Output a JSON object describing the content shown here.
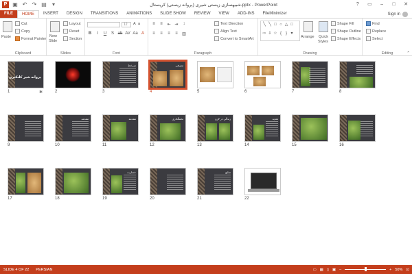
{
  "titlebar": {
    "app_icon": "P",
    "title": "شبیهسازی زیستی شیری (پروانه زیستی) کریستال.pptx - PowerPoint",
    "controls": [
      "?",
      "▭",
      "–",
      "□",
      "✕"
    ]
  },
  "tabs": [
    "FILE",
    "HOME",
    "INSERT",
    "DESIGN",
    "TRANSITIONS",
    "ANIMATIONS",
    "SLIDE SHOW",
    "REVIEW",
    "VIEW",
    "ADD-INS",
    "FileMinimizer"
  ],
  "active_tab": "HOME",
  "signin": "Sign in",
  "ribbon": {
    "clipboard": {
      "label": "Clipboard",
      "paste": "Paste",
      "cut": "Cut",
      "copy": "Copy",
      "format_painter": "Format Painter"
    },
    "slides": {
      "label": "Slides",
      "new_slide": "New",
      "new_slide2": "Slide",
      "layout": "Layout",
      "reset": "Reset",
      "section": "Section"
    },
    "font": {
      "label": "Font",
      "font_size": "12",
      "format": [
        "B",
        "I",
        "U",
        "S",
        "ab",
        "AV",
        "Aa",
        "A"
      ]
    },
    "paragraph": {
      "label": "Paragraph",
      "text_direction": "Text Direction",
      "align_text": "Align Text",
      "convert_smartart": "Convert to SmartArt"
    },
    "drawing": {
      "label": "Drawing",
      "arrange": "Arrange",
      "quick_styles": "Quick",
      "quick_styles2": "Styles",
      "shape_fill": "Shape Fill",
      "shape_outline": "Shape Outline",
      "shape_effects": "Shape Effects"
    },
    "editing": {
      "label": "Editing",
      "find": "Find",
      "replace": "Replace",
      "select": "Select"
    }
  },
  "slides": [
    {
      "num": "1",
      "title": "پروانه شیر کلنکتری"
    },
    {
      "num": "2",
      "title": ""
    },
    {
      "num": "3",
      "title": "سرخط"
    },
    {
      "num": "4",
      "title": "معرفی"
    },
    {
      "num": "5",
      "title": ""
    },
    {
      "num": "6",
      "title": ""
    },
    {
      "num": "7",
      "title": ""
    },
    {
      "num": "8",
      "title": ""
    },
    {
      "num": "9",
      "title": ""
    },
    {
      "num": "10",
      "title": "مقدمه"
    },
    {
      "num": "11",
      "title": "مقدمه"
    },
    {
      "num": "12",
      "title": "تخمگذاری"
    },
    {
      "num": "13",
      "title": "زندگی در لارو"
    },
    {
      "num": "14",
      "title": "تغذیه"
    },
    {
      "num": "15",
      "title": ""
    },
    {
      "num": "16",
      "title": ""
    },
    {
      "num": "17",
      "title": ""
    },
    {
      "num": "18",
      "title": ""
    },
    {
      "num": "19",
      "title": "خسارت"
    },
    {
      "num": "20",
      "title": ""
    },
    {
      "num": "21",
      "title": "منابع"
    },
    {
      "num": "22",
      "title": ""
    }
  ],
  "selected_slide": "4",
  "status": {
    "slide_info": "SLIDE 4 OF 22",
    "language": "PERSIAN",
    "zoom_label": "50%",
    "zoom_level": 0.5
  },
  "colors": {
    "accent": "#c43e1c",
    "selected": "#d35230"
  }
}
